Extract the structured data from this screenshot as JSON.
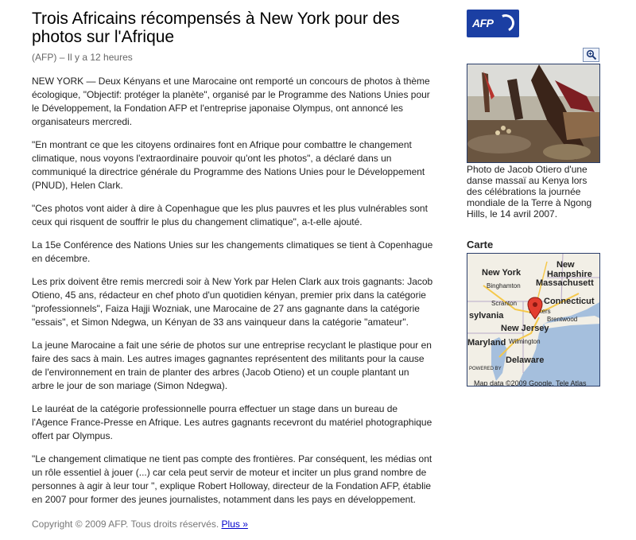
{
  "article": {
    "title": "Trois Africains récompensés à New York pour des photos sur l'Afrique",
    "source": "(AFP)",
    "time": "– Il y a 12 heures",
    "paragraphs": [
      "NEW YORK — Deux Kényans et une Marocaine ont remporté un concours de photos à thème écologique, \"Objectif: protéger la planète\", organisé par le Programme des Nations Unies pour le Développement, la Fondation AFP et l'entreprise japonaise Olympus, ont annoncé les organisateurs mercredi.",
      "\"En montrant ce que les citoyens ordinaires font en Afrique pour combattre le changement climatique, nous voyons l'extraordinaire pouvoir qu'ont les photos\", a déclaré dans un communiqué la directrice générale du Programme des Nations Unies pour le Développement (PNUD), Helen Clark.",
      "\"Ces photos vont aider à dire à Copenhague que les plus pauvres et les plus vulnérables sont ceux qui risquent de souffrir le plus du changement climatique\", a-t-elle ajouté.",
      "La 15e Conférence des Nations Unies sur les changements climatiques se tient à Copenhague en décembre.",
      "Les prix doivent être remis mercredi soir à New York par Helen Clark aux trois gagnants: Jacob Otieno, 45 ans, rédacteur en chef photo d'un quotidien kényan, premier prix dans la catégorie \"professionnels\", Faiza Hajji Wozniak, une Marocaine de 27 ans gagnante dans la catégorie \"essais\", et Simon Ndegwa, un Kényan de 33 ans vainqueur dans la catégorie \"amateur\".",
      "La jeune Marocaine a fait une série de photos sur une entreprise recyclant le plastique pour en faire des sacs à main. Les autres images gagnantes représentent des militants pour la cause de l'environnement en train de planter des arbres (Jacob Otieno) et un couple plantant un arbre le jour de son mariage (Simon Ndegwa).",
      "Le lauréat de la catégorie professionnelle pourra effectuer un stage dans un bureau de l'Agence France-Presse en Afrique. Les autres gagnants recevront du matériel photographique offert par Olympus.",
      "\"Le changement climatique ne tient pas compte des frontières. Par conséquent, les médias ont un rôle essentiel à jouer (...) car cela peut servir de moteur et inciter un plus grand nombre de personnes à agir à leur tour \", explique Robert Holloway, directeur de la Fondation AFP, établie en 2007 pour former des jeunes journalistes, notamment dans les pays en développement."
    ],
    "copyright": "Copyright © 2009 AFP. Tous droits réservés.",
    "more_link": "Plus »"
  },
  "sidebar": {
    "logo_text": "AFP",
    "zoom_icon": "magnifier-icon",
    "photo_caption": "Photo de Jacob Otiero d'une danse massaï au Kenya lors des célébrations la journée mondiale de la Terre à Ngong Hills, le 14 avril 2007.",
    "map_title": "Carte",
    "map": {
      "labels": {
        "new_hampshire_1": "New",
        "new_hampshire_2": "Hampshire",
        "new_york": "New York",
        "massachusetts": "Massachusett",
        "binghamton": "Binghamton",
        "connecticut": "Connecticut",
        "scranton": "Scranton",
        "pennsylvania": "sylvania",
        "brentwood": "Brentwood",
        "new_jersey": "New Jersey",
        "yonkers": "Yonkers",
        "maryland": "Maryland",
        "wilmington": "Wilmington",
        "delaware": "Delaware",
        "powered": "POWERED BY",
        "data_credit": "Map data ©2009 Google, Tele Atlas"
      }
    },
    "colors": {
      "logo_blue": "#1b3fa3",
      "map_water": "#a5bfdd",
      "map_land": "#f2efe6",
      "marker": "#e33d2f"
    }
  }
}
